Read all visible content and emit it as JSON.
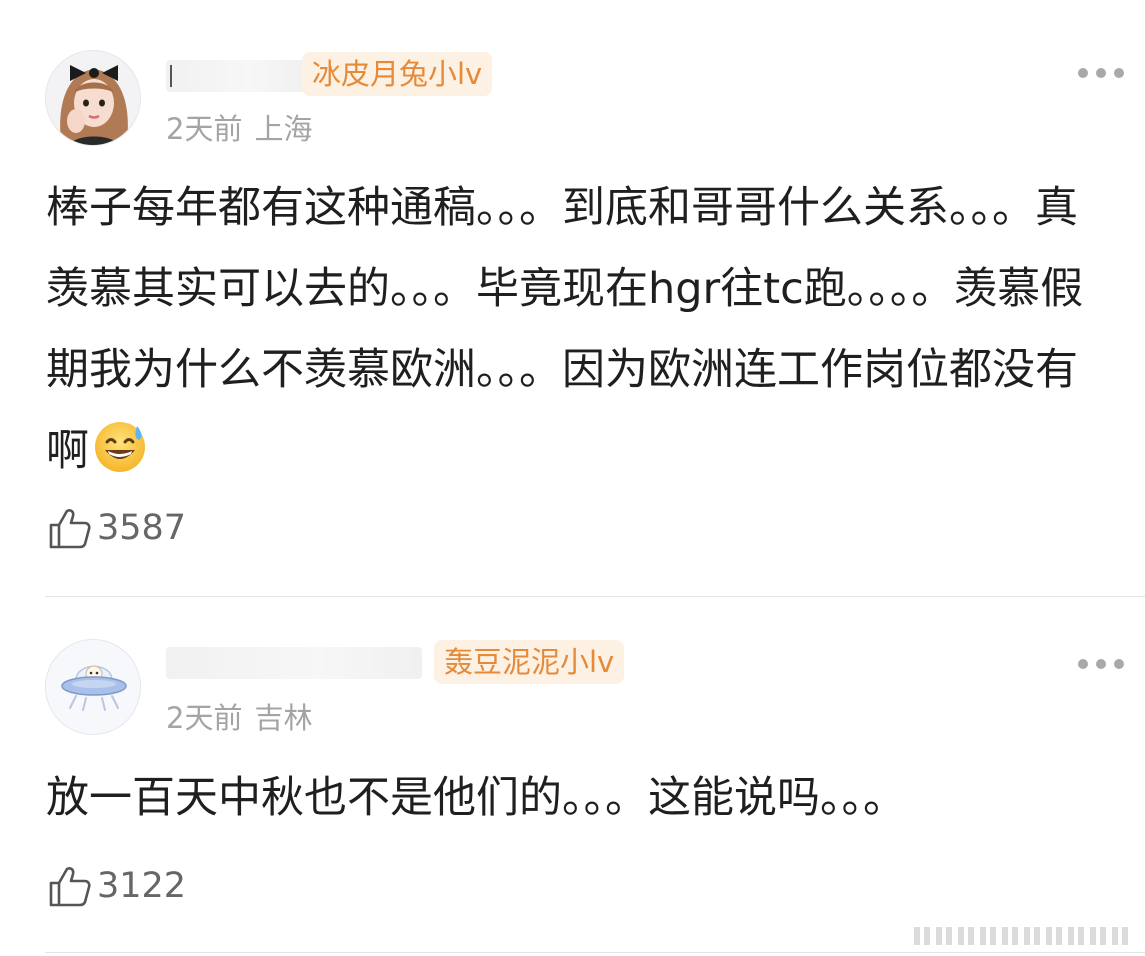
{
  "comments": [
    {
      "badge": "冰皮月兔小lv",
      "time": "2天前",
      "location": "上海",
      "text": "棒子每年都有这种通稿。。。到底和哥哥什么关系。。。真羡慕其实可以去的。。。毕竟现在hgr往tc跑。。。。羡慕假期我为什么不羡慕欧洲。。。因为欧洲连工作岗位都没有啊",
      "emoji": "grinning-face-with-sweat",
      "likes": "3587",
      "avatar": "woman-portrait"
    },
    {
      "badge": "轰豆泥泥小lv",
      "time": "2天前",
      "location": "吉林",
      "text": "放一百天中秋也不是他们的。。。这能说吗。。。",
      "likes": "3122",
      "avatar": "ufo-cartoon"
    }
  ],
  "icons": {
    "more": "more-dots-icon",
    "like": "thumbs-up-icon"
  },
  "colors": {
    "badge_text": "#e48a39",
    "badge_bg": "#fdf1e4",
    "meta": "#a4a4a4",
    "body": "#1f1f1f"
  }
}
